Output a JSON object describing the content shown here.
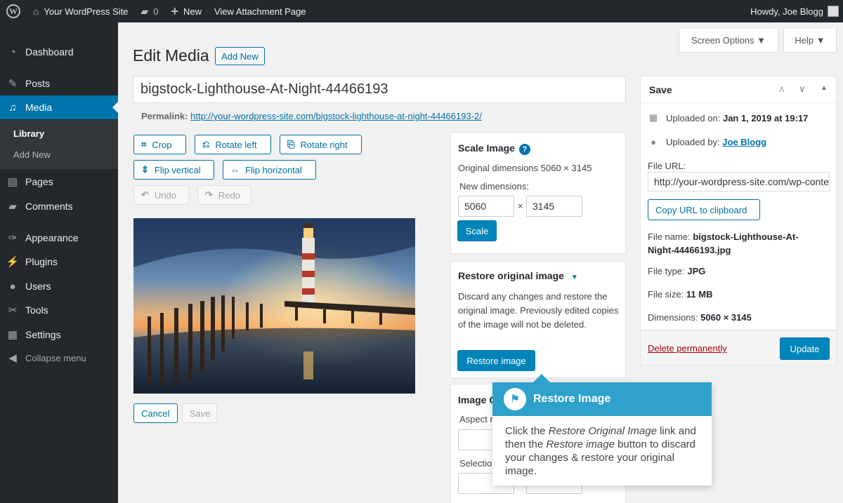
{
  "admin_bar": {
    "site_name": "Your WordPress Site",
    "comments_count": "0",
    "new_label": "New",
    "view_label": "View Attachment Page",
    "greeting": "Howdy, Joe Blogg"
  },
  "sidebar": {
    "items": [
      {
        "label": "Dashboard",
        "icon": "dashboard-icon"
      },
      {
        "label": "Posts",
        "icon": "pin-icon"
      },
      {
        "label": "Media",
        "icon": "media-icon"
      },
      {
        "label": "Pages",
        "icon": "pages-icon"
      },
      {
        "label": "Comments",
        "icon": "comments-icon"
      },
      {
        "label": "Appearance",
        "icon": "brush-icon"
      },
      {
        "label": "Plugins",
        "icon": "plugin-icon"
      },
      {
        "label": "Users",
        "icon": "users-icon"
      },
      {
        "label": "Tools",
        "icon": "wrench-icon"
      },
      {
        "label": "Settings",
        "icon": "settings-icon"
      }
    ],
    "submenu": [
      "Library",
      "Add New"
    ],
    "collapse": "Collapse menu"
  },
  "screen_options": "Screen Options ▼",
  "help": "Help ▼",
  "header": {
    "title": "Edit Media",
    "add_new": "Add New"
  },
  "editor": {
    "title_value": "bigstock-Lighthouse-At-Night-44466193",
    "permalink_label": "Permalink:",
    "permalink_url": "http://your-wordpress-site.com/bigstock-lighthouse-at-night-44466193-2/",
    "crop": "Crop",
    "rotate_left": "Rotate left",
    "rotate_right": "Rotate right",
    "flip_vertical": "Flip vertical",
    "flip_horizontal": "Flip horizontal",
    "undo": "Undo",
    "redo": "Redo",
    "cancel": "Cancel",
    "save": "Save"
  },
  "scale": {
    "title": "Scale Image",
    "original": "Original dimensions 5060 × 3145",
    "new_label": "New dimensions:",
    "width": "5060",
    "times": "×",
    "height": "3145",
    "button": "Scale"
  },
  "restore": {
    "title": "Restore original image",
    "text": "Discard any changes and restore the original image. Previously edited copies of the image will not be deleted.",
    "button": "Restore image"
  },
  "image_crop": {
    "title_partial": "Image C",
    "aspect_partial": "Aspect r",
    "selection_partial": "Selectio"
  },
  "save_box": {
    "title": "Save",
    "uploaded_on_label": "Uploaded on:",
    "uploaded_on_value": "Jan 1, 2019 at 19:17",
    "uploaded_by_label": "Uploaded by:",
    "uploaded_by_value": "Joe Blogg",
    "file_url_label": "File URL:",
    "file_url_value": "http://your-wordpress-site.com/wp-content/uploads",
    "copy_button": "Copy URL to clipboard",
    "file_name_label": "File name:",
    "file_name_value": "bigstock-Lighthouse-At-Night-44466193.jpg",
    "file_type_label": "File type:",
    "file_type_value": "JPG",
    "file_size_label": "File size:",
    "file_size_value": "11 MB",
    "dimensions_label": "Dimensions:",
    "dimensions_value": "5060 × 3145",
    "delete": "Delete permanently",
    "update": "Update"
  },
  "tooltip": {
    "title": "Restore Image",
    "p1": "Click the ",
    "em1": "Restore Original Image",
    "p2": " link and then the ",
    "em2": "Restore image",
    "p3": " button to discard your changes & restore your original image."
  }
}
